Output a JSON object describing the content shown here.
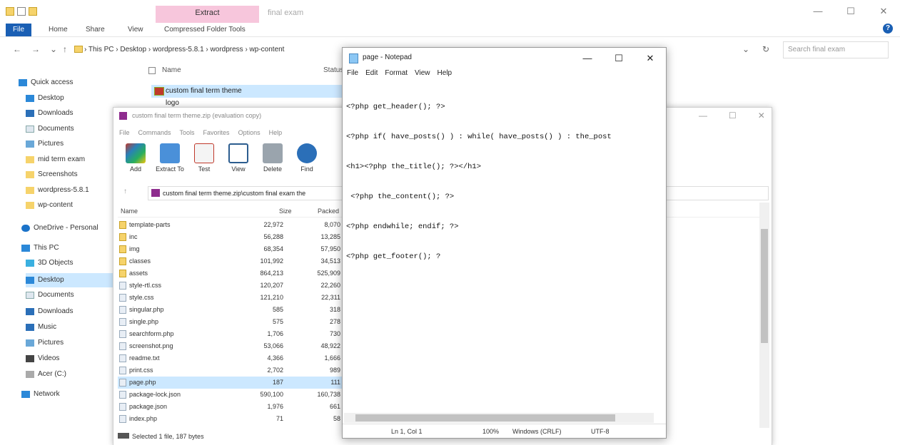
{
  "explorer": {
    "context_tab": "Extract",
    "window_title": "final exam",
    "ribbon_tabs": [
      "File",
      "Home",
      "Share",
      "View",
      "Compressed Folder Tools"
    ],
    "address": "› This PC › Desktop › wordpress-5.8.1 › wordpress › wp-content",
    "search_placeholder": "Search final exam",
    "nav_items": [
      {
        "label": "Quick access",
        "icon": "star-icon"
      },
      {
        "label": "Desktop",
        "icon": "desktop-icon"
      },
      {
        "label": "Downloads",
        "icon": "download-icon"
      },
      {
        "label": "Documents",
        "icon": "documents-icon"
      },
      {
        "label": "Pictures",
        "icon": "pictures-icon"
      },
      {
        "label": "mid term exam",
        "icon": "folder-icon"
      },
      {
        "label": "Screenshots",
        "icon": "folder-icon"
      },
      {
        "label": "wordpress-5.8.1",
        "icon": "folder-icon"
      },
      {
        "label": "wp-content",
        "icon": "folder-icon"
      },
      {
        "label": "OneDrive - Personal",
        "icon": "cloud-icon"
      },
      {
        "label": "This PC",
        "icon": "pc-icon"
      },
      {
        "label": "3D Objects",
        "icon": "objects-icon"
      },
      {
        "label": "Desktop",
        "icon": "desktop-icon"
      },
      {
        "label": "Documents",
        "icon": "documents-icon"
      },
      {
        "label": "Downloads",
        "icon": "download-icon"
      },
      {
        "label": "Music",
        "icon": "music-icon"
      },
      {
        "label": "Pictures",
        "icon": "pictures-icon"
      },
      {
        "label": "Videos",
        "icon": "videos-icon"
      },
      {
        "label": "Acer (C:)",
        "icon": "drive-icon"
      },
      {
        "label": "Network",
        "icon": "network-icon"
      }
    ],
    "column_name": "Name",
    "column_status": "Status",
    "files": [
      "custom final term theme",
      "logo"
    ]
  },
  "winrar": {
    "title": "custom final term theme.zip (evaluation copy)",
    "menu": [
      "File",
      "Commands",
      "Tools",
      "Favorites",
      "Options",
      "Help"
    ],
    "tools": [
      "Add",
      "Extract To",
      "Test",
      "View",
      "Delete",
      "Find"
    ],
    "path": "custom final term theme.zip\\custom final exam the",
    "columns": {
      "name": "Name",
      "size": "Size",
      "packed": "Packed"
    },
    "rows": [
      {
        "name": "template-parts",
        "size": "22,972",
        "packed": "8,070"
      },
      {
        "name": "inc",
        "size": "56,288",
        "packed": "13,285"
      },
      {
        "name": "img",
        "size": "68,354",
        "packed": "57,950"
      },
      {
        "name": "classes",
        "size": "101,992",
        "packed": "34,513"
      },
      {
        "name": "assets",
        "size": "864,213",
        "packed": "525,909"
      },
      {
        "name": "style-rtl.css",
        "size": "120,207",
        "packed": "22,260"
      },
      {
        "name": "style.css",
        "size": "121,210",
        "packed": "22,311"
      },
      {
        "name": "singular.php",
        "size": "585",
        "packed": "318"
      },
      {
        "name": "single.php",
        "size": "575",
        "packed": "278"
      },
      {
        "name": "searchform.php",
        "size": "1,706",
        "packed": "730"
      },
      {
        "name": "screenshot.png",
        "size": "53,066",
        "packed": "48,922"
      },
      {
        "name": "readme.txt",
        "size": "4,366",
        "packed": "1,666"
      },
      {
        "name": "print.css",
        "size": "2,702",
        "packed": "989"
      },
      {
        "name": "page.php",
        "size": "187",
        "packed": "111"
      },
      {
        "name": "package-lock.json",
        "size": "590,100",
        "packed": "160,738"
      },
      {
        "name": "package.json",
        "size": "1,976",
        "packed": "661"
      },
      {
        "name": "index.php",
        "size": "71",
        "packed": "58"
      }
    ],
    "status": "Selected 1 file, 187 bytes"
  },
  "notepad": {
    "title": "page - Notepad",
    "menu": [
      "File",
      "Edit",
      "Format",
      "View",
      "Help"
    ],
    "lines": [
      "<?php get_header(); ?>",
      "<?php if( have_posts() ) : while( have_posts() ) : the_post",
      "<h1><?php the_title(); ?></h1>",
      " <?php the_content(); ?>",
      "<?php endwhile; endif; ?>",
      "<?php get_footer(); ?"
    ],
    "status": {
      "position": "Ln 1, Col 1",
      "zoom": "100%",
      "line_ending": "Windows (CRLF)",
      "encoding": "UTF-8"
    }
  }
}
